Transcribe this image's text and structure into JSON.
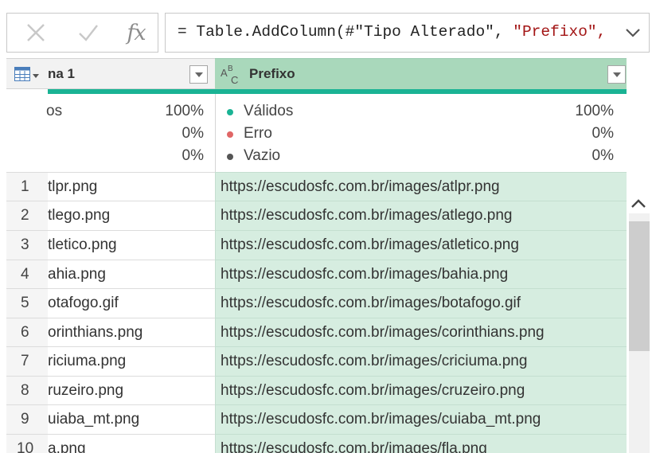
{
  "formula_bar": {
    "cancel_icon": "close-icon",
    "commit_icon": "check-icon",
    "fx_label": "fx",
    "formula_prefix": "= Table.AddColumn(#\"Tipo Alterado\", ",
    "formula_string": "\"Prefixo\",",
    "expand_icon": "chevron-down-icon"
  },
  "columns": [
    {
      "title": "na 1",
      "type_icon": "table-icon"
    },
    {
      "title": "Prefixo",
      "type_icon": "text-type-icon"
    }
  ],
  "quality": {
    "left": [
      {
        "label": "os",
        "value": "100%"
      },
      {
        "label": "",
        "value": "0%"
      },
      {
        "label": "",
        "value": "0%"
      }
    ],
    "right": [
      {
        "label": "Válidos",
        "value": "100%",
        "color": "#1ab394"
      },
      {
        "label": "Erro",
        "value": "0%",
        "color": "#e06666"
      },
      {
        "label": "Vazio",
        "value": "0%",
        "color": "#555555"
      }
    ]
  },
  "rows": [
    {
      "n": "1",
      "a": "tlpr.png",
      "b": "https://escudosfc.com.br/images/atlpr.png"
    },
    {
      "n": "2",
      "a": "tlego.png",
      "b": "https://escudosfc.com.br/images/atlego.png"
    },
    {
      "n": "3",
      "a": "tletico.png",
      "b": "https://escudosfc.com.br/images/atletico.png"
    },
    {
      "n": "4",
      "a": "ahia.png",
      "b": "https://escudosfc.com.br/images/bahia.png"
    },
    {
      "n": "5",
      "a": "otafogo.gif",
      "b": "https://escudosfc.com.br/images/botafogo.gif"
    },
    {
      "n": "6",
      "a": "orinthians.png",
      "b": "https://escudosfc.com.br/images/corinthians.png"
    },
    {
      "n": "7",
      "a": "riciuma.png",
      "b": "https://escudosfc.com.br/images/criciuma.png"
    },
    {
      "n": "8",
      "a": "ruzeiro.png",
      "b": "https://escudosfc.com.br/images/cruzeiro.png"
    },
    {
      "n": "9",
      "a": "uiaba_mt.png",
      "b": "https://escudosfc.com.br/images/cuiaba_mt.png"
    },
    {
      "n": "10",
      "a": "a.png",
      "b": "https://escudosfc.com.br/images/fla.png"
    }
  ],
  "scrollbar": {
    "up_icon": "chevron-up-icon"
  }
}
